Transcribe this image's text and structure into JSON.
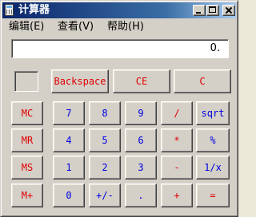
{
  "window": {
    "title": "计算器"
  },
  "menu": [
    "编辑(E)",
    "查看(V)",
    "帮助(H)"
  ],
  "display": {
    "value": "0."
  },
  "buttons": {
    "backspace": "Backspace",
    "ce": "CE",
    "c": "C",
    "mc": "MC",
    "mr": "MR",
    "ms": "MS",
    "mplus": "M+",
    "d7": "7",
    "d8": "8",
    "d9": "9",
    "d4": "4",
    "d5": "5",
    "d6": "6",
    "d1": "1",
    "d2": "2",
    "d3": "3",
    "d0": "0",
    "sign": "+/-",
    "dot": ".",
    "div": "/",
    "mul": "*",
    "sub": "-",
    "add": "+",
    "sqrt": "sqrt",
    "pct": "%",
    "inv": "1/x",
    "eq": "="
  },
  "colors": {
    "operator": "#e00000",
    "digit": "#0000e0",
    "title_bar": "#0a246a"
  }
}
